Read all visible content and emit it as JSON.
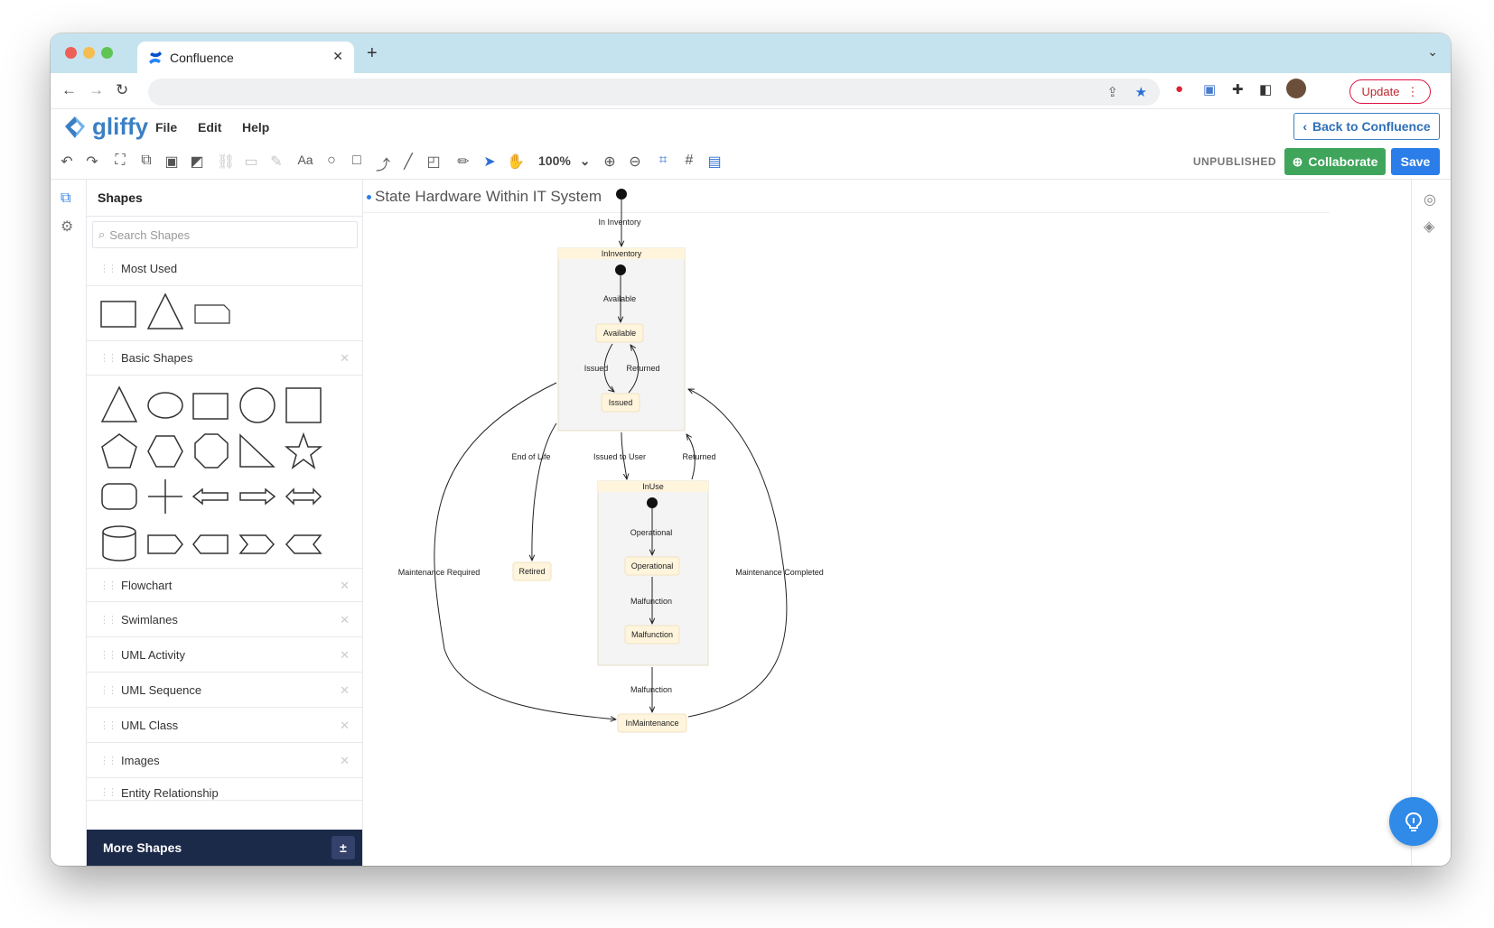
{
  "browser": {
    "tab_title": "Confluence",
    "tab_close": "✕",
    "new_tab": "+",
    "update_label": "Update"
  },
  "app": {
    "logo_text": "gliffy",
    "menu": [
      "File",
      "Edit",
      "Help"
    ],
    "back_label": "Back to Confluence"
  },
  "toolbar": {
    "zoom": "100%",
    "status": "UNPUBLISHED",
    "collaborate_label": "Collaborate",
    "save_label": "Save"
  },
  "shapes_panel": {
    "title": "Shapes",
    "search_placeholder": "Search Shapes",
    "sections": [
      "Most Used",
      "Basic Shapes",
      "Flowchart",
      "Swimlanes",
      "UML Activity",
      "UML Sequence",
      "UML Class",
      "Images",
      "Entity Relationship"
    ],
    "more_shapes_label": "More Shapes"
  },
  "document": {
    "title": "State Hardware Within IT System"
  },
  "diagram": {
    "states": {
      "in_inventory": "InInventory",
      "available": "Available",
      "issued": "Issued",
      "in_use": "InUse",
      "operational": "Operational",
      "malfunction": "Malfunction",
      "retired": "Retired",
      "in_maintenance": "InMaintenance"
    },
    "transitions": {
      "in_inventory": "In Inventory",
      "available": "Available",
      "issued": "Issued",
      "returned_inner": "Returned",
      "end_of_life": "End of Life",
      "issued_to_user": "Issued to User",
      "returned_outer": "Returned",
      "operational": "Operational",
      "malfunction_inner": "Malfunction",
      "malfunction_outer": "Malfunction",
      "maintenance_required": "Maintenance Required",
      "maintenance_completed": "Maintenance Completed"
    }
  },
  "colors": {
    "accent": "#2b7de9",
    "collaborate": "#3fa55b",
    "more_shapes_bg": "#1c2a4a",
    "state_fill": "#fff4dc",
    "composite_fill": "#f4f4f4"
  }
}
